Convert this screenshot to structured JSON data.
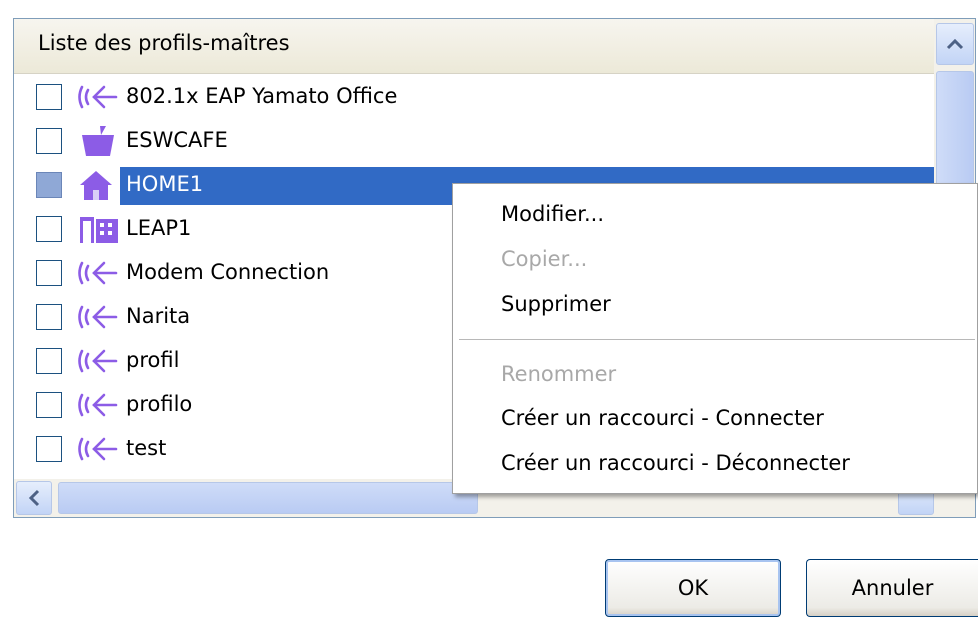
{
  "list": {
    "header": "Liste des profils-maîtres",
    "items": [
      {
        "label": "802.1x EAP Yamato Office",
        "icon": "wireless-icon",
        "selected": false
      },
      {
        "label": "ESWCAFE",
        "icon": "coffee-cup-icon",
        "selected": false
      },
      {
        "label": "HOME1",
        "icon": "house-icon",
        "selected": true
      },
      {
        "label": "LEAP1",
        "icon": "building-icon",
        "selected": false
      },
      {
        "label": "Modem Connection",
        "icon": "wireless-icon",
        "selected": false
      },
      {
        "label": "Narita",
        "icon": "wireless-icon",
        "selected": false
      },
      {
        "label": "profil",
        "icon": "wireless-icon",
        "selected": false
      },
      {
        "label": "profilo",
        "icon": "wireless-icon",
        "selected": false
      },
      {
        "label": "test",
        "icon": "wireless-icon",
        "selected": false
      }
    ]
  },
  "context_menu": {
    "items": [
      {
        "label": "Modifier...",
        "enabled": true
      },
      {
        "label": "Copier...",
        "enabled": false
      },
      {
        "label": "Supprimer",
        "enabled": true
      },
      {
        "label": "Renommer",
        "enabled": false
      },
      {
        "label": "Créer un raccourci - Connecter",
        "enabled": true
      },
      {
        "label": "Créer un raccourci - Déconnecter",
        "enabled": true
      }
    ]
  },
  "buttons": {
    "ok": "OK",
    "cancel": "Annuler"
  },
  "colors": {
    "selection": "#316ac5",
    "icon": "#8c5ce6"
  }
}
